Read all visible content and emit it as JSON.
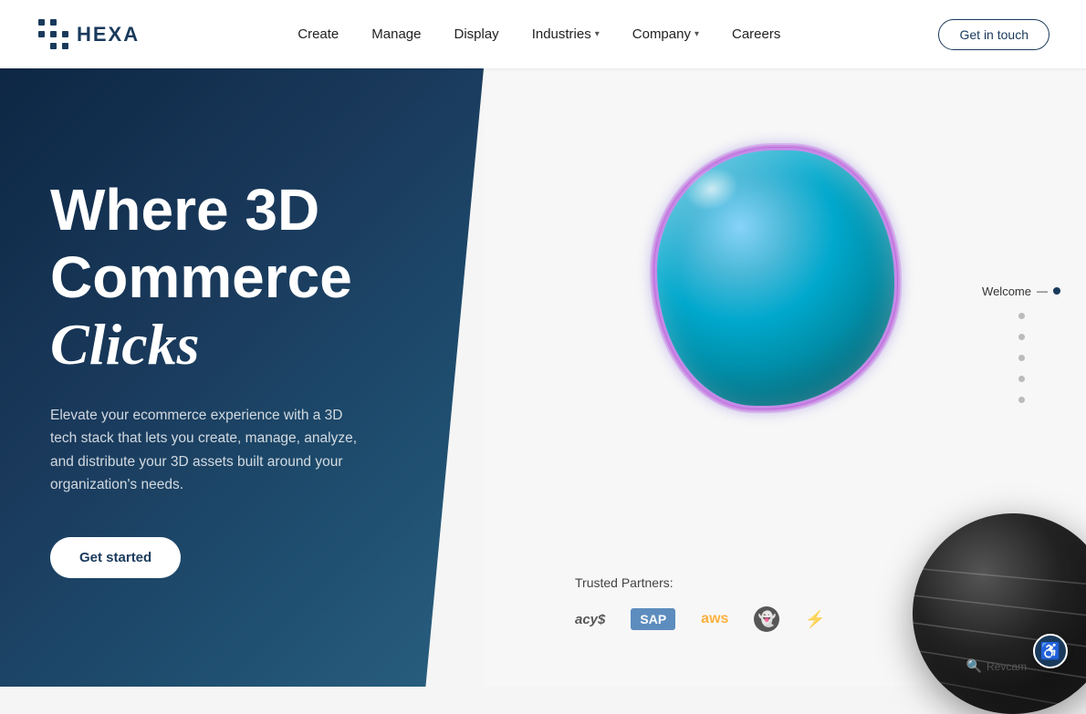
{
  "brand": {
    "name": "HEXA",
    "tagline": "Where 3D Commerce Clicks"
  },
  "nav": {
    "logo_text": "HEXA",
    "links": [
      {
        "label": "Create",
        "has_dropdown": false
      },
      {
        "label": "Manage",
        "has_dropdown": false
      },
      {
        "label": "Display",
        "has_dropdown": false
      },
      {
        "label": "Industries",
        "has_dropdown": true
      },
      {
        "label": "Company",
        "has_dropdown": true
      },
      {
        "label": "Careers",
        "has_dropdown": false
      }
    ],
    "cta_label": "Get in touch"
  },
  "hero": {
    "headline_line1": "Where 3D",
    "headline_line2": "Commerce",
    "headline_line3": "Clicks",
    "subtext": "Elevate your ecommerce experience with a 3D tech stack that lets you create, manage, analyze, and distribute your 3D assets built around your organization's needs.",
    "cta_label": "Get started"
  },
  "trusted": {
    "label": "Trusted Partners:",
    "partners": [
      {
        "name": "acy$",
        "type": "acy"
      },
      {
        "name": "SAP",
        "type": "sap"
      },
      {
        "name": "aws",
        "type": "aws"
      },
      {
        "name": "👻",
        "type": "snap"
      },
      {
        "name": "⚡",
        "type": "unreal"
      }
    ]
  },
  "scroll_nav": {
    "active_label": "Welcome",
    "dots": [
      {
        "active": true
      },
      {
        "active": false
      },
      {
        "active": false
      },
      {
        "active": false
      },
      {
        "active": false
      },
      {
        "active": false
      }
    ]
  },
  "accessibility": {
    "icon": "♿"
  }
}
